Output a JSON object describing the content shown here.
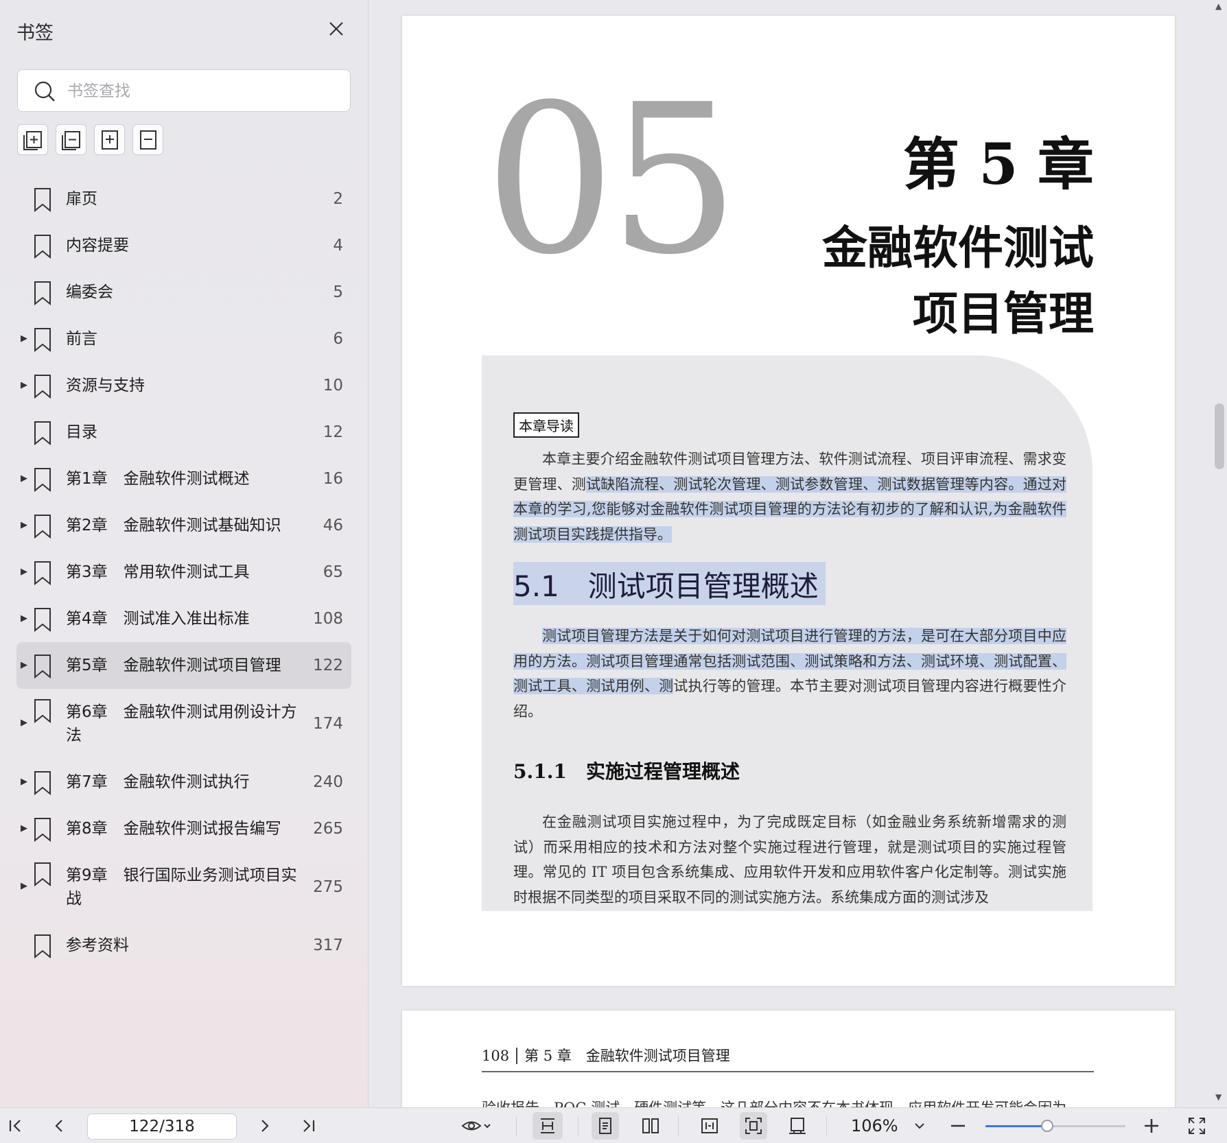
{
  "sidebar": {
    "title": "书签",
    "search_placeholder": "书签查找",
    "tools": [
      "add-bookmark-icon",
      "remove-bookmark-icon",
      "expand-bookmark-icon",
      "collapse-bookmark-icon"
    ],
    "bookmarks": [
      {
        "label": "扉页",
        "page": "2",
        "expandable": false,
        "active": false
      },
      {
        "label": "内容提要",
        "page": "4",
        "expandable": false,
        "active": false
      },
      {
        "label": "编委会",
        "page": "5",
        "expandable": false,
        "active": false
      },
      {
        "label": "前言",
        "page": "6",
        "expandable": true,
        "active": false
      },
      {
        "label": "资源与支持",
        "page": "10",
        "expandable": true,
        "active": false
      },
      {
        "label": "目录",
        "page": "12",
        "expandable": false,
        "active": false
      },
      {
        "label": "第1章　金融软件测试概述",
        "page": "16",
        "expandable": true,
        "active": false
      },
      {
        "label": "第2章　金融软件测试基础知识",
        "page": "46",
        "expandable": true,
        "active": false
      },
      {
        "label": "第3章　常用软件测试工具",
        "page": "65",
        "expandable": true,
        "active": false
      },
      {
        "label": "第4章　测试准入准出标准",
        "page": "108",
        "expandable": true,
        "active": false
      },
      {
        "label": "第5章　金融软件测试项目管理",
        "page": "122",
        "expandable": true,
        "active": true
      },
      {
        "label": "第6章　金融软件测试用例设计方\n法",
        "page": "174",
        "expandable": true,
        "active": false
      },
      {
        "label": "第7章　金融软件测试执行",
        "page": "240",
        "expandable": true,
        "active": false
      },
      {
        "label": "第8章　金融软件测试报告编写",
        "page": "265",
        "expandable": true,
        "active": false
      },
      {
        "label": "第9章　银行国际业务测试项目实\n战",
        "page": "275",
        "expandable": true,
        "active": false
      },
      {
        "label": "参考资料",
        "page": "317",
        "expandable": false,
        "active": false
      }
    ]
  },
  "document": {
    "big_number": "05",
    "chapter_no": "第 5 章",
    "chapter_title_line1": "金融软件测试",
    "chapter_title_line2": "项目管理",
    "guide_tag": "本章导读",
    "guide_para_a": "本章主要介绍金融软件测试项目管理方法、软件测试流程、项目评审流程、需求变更管理、测",
    "guide_para_b": "试缺陷流程、测试轮次管理、测试参数管理、测试数据管理等内容。通过对本章的学习,您能够对金融软件测试项目管理的方法论有初步的了解和认识,为金融软件测试项目实践提供指导。",
    "section_heading": "5.1　测试项目管理概述",
    "sec_para_a": "测试项目管理方法是关于如何对测试项目进行管理的方法，是可在大部分项目中应用的方法。测试项目管理通常包括测试范围、测试策略和方法、测试环境、测试配置、测试工具、测试用例、测",
    "sec_para_b": "试执行等的管理。本节主要对测试项目管理内容进行概要性介绍。",
    "subsection_heading": "5.1.1　实施过程管理概述",
    "sub_para": "在金融测试项目实施过程中，为了完成既定目标（如金融业务系统新增需求的测试）而采用相应的技术和方法对整个实施过程进行管理，就是测试项目的实施过程管理。常见的 IT 项目包含系统集成、应用软件开发和应用软件客户化定制等。测试实施时根据不同类型的项目采取不同的测试实施方法。系统集成方面的测试涉及",
    "page2_number": "108",
    "page2_header": "第 5 章　金融软件测试项目管理",
    "page2_body": "验收报告、POC 测试、硬件测试等，这几部分内容不在本书体现。应用软件开发可能会因为"
  },
  "toolbar": {
    "page_indicator": "122/318",
    "zoom_label": "106%",
    "zoom_fraction": 0.44
  },
  "colors": {
    "highlight": "#c3d1ea",
    "zoom_accent": "#3a78e0",
    "active_row": "#d9d7dc"
  }
}
